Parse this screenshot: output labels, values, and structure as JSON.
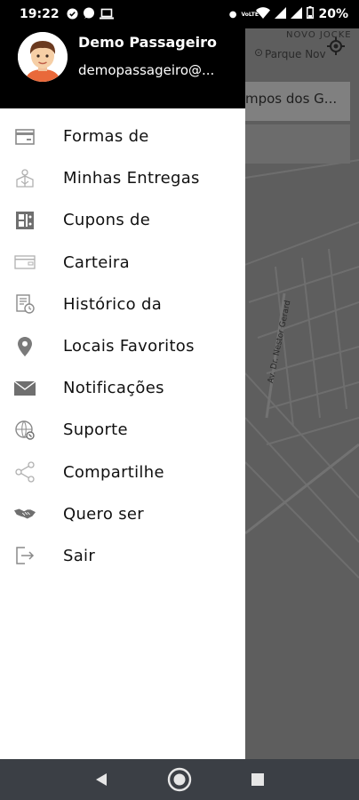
{
  "status_bar": {
    "time": "19:22",
    "battery": "20%",
    "network": "VoLTE"
  },
  "map": {
    "search_text": "mpos dos G...",
    "place_neighborhood": "NOVO JOCKE",
    "place_park": "Parque Nov",
    "street_name": "Av. Dr. Nestor Gerard"
  },
  "drawer": {
    "user": {
      "name": "Demo Passageiro",
      "email": "demopassageiro@..."
    },
    "menu_items": [
      {
        "label": "Formas de",
        "icon": "wallet-card-icon"
      },
      {
        "label": "Minhas Entregas",
        "icon": "delivery-box-icon"
      },
      {
        "label": "Cupons de",
        "icon": "coupon-icon"
      },
      {
        "label": "Carteira",
        "icon": "wallet-icon"
      },
      {
        "label": "Histórico da",
        "icon": "history-icon"
      },
      {
        "label": "Locais Favoritos",
        "icon": "location-pin-icon"
      },
      {
        "label": "Notificações",
        "icon": "envelope-icon"
      },
      {
        "label": "Suporte",
        "icon": "support-icon"
      },
      {
        "label": "Compartilhe",
        "icon": "share-icon"
      },
      {
        "label": "Quero ser",
        "icon": "handshake-icon"
      },
      {
        "label": "Sair",
        "icon": "logout-icon"
      }
    ]
  },
  "nav_bar": {
    "back": "back-icon",
    "home": "home-icon",
    "recents": "recents-icon"
  }
}
